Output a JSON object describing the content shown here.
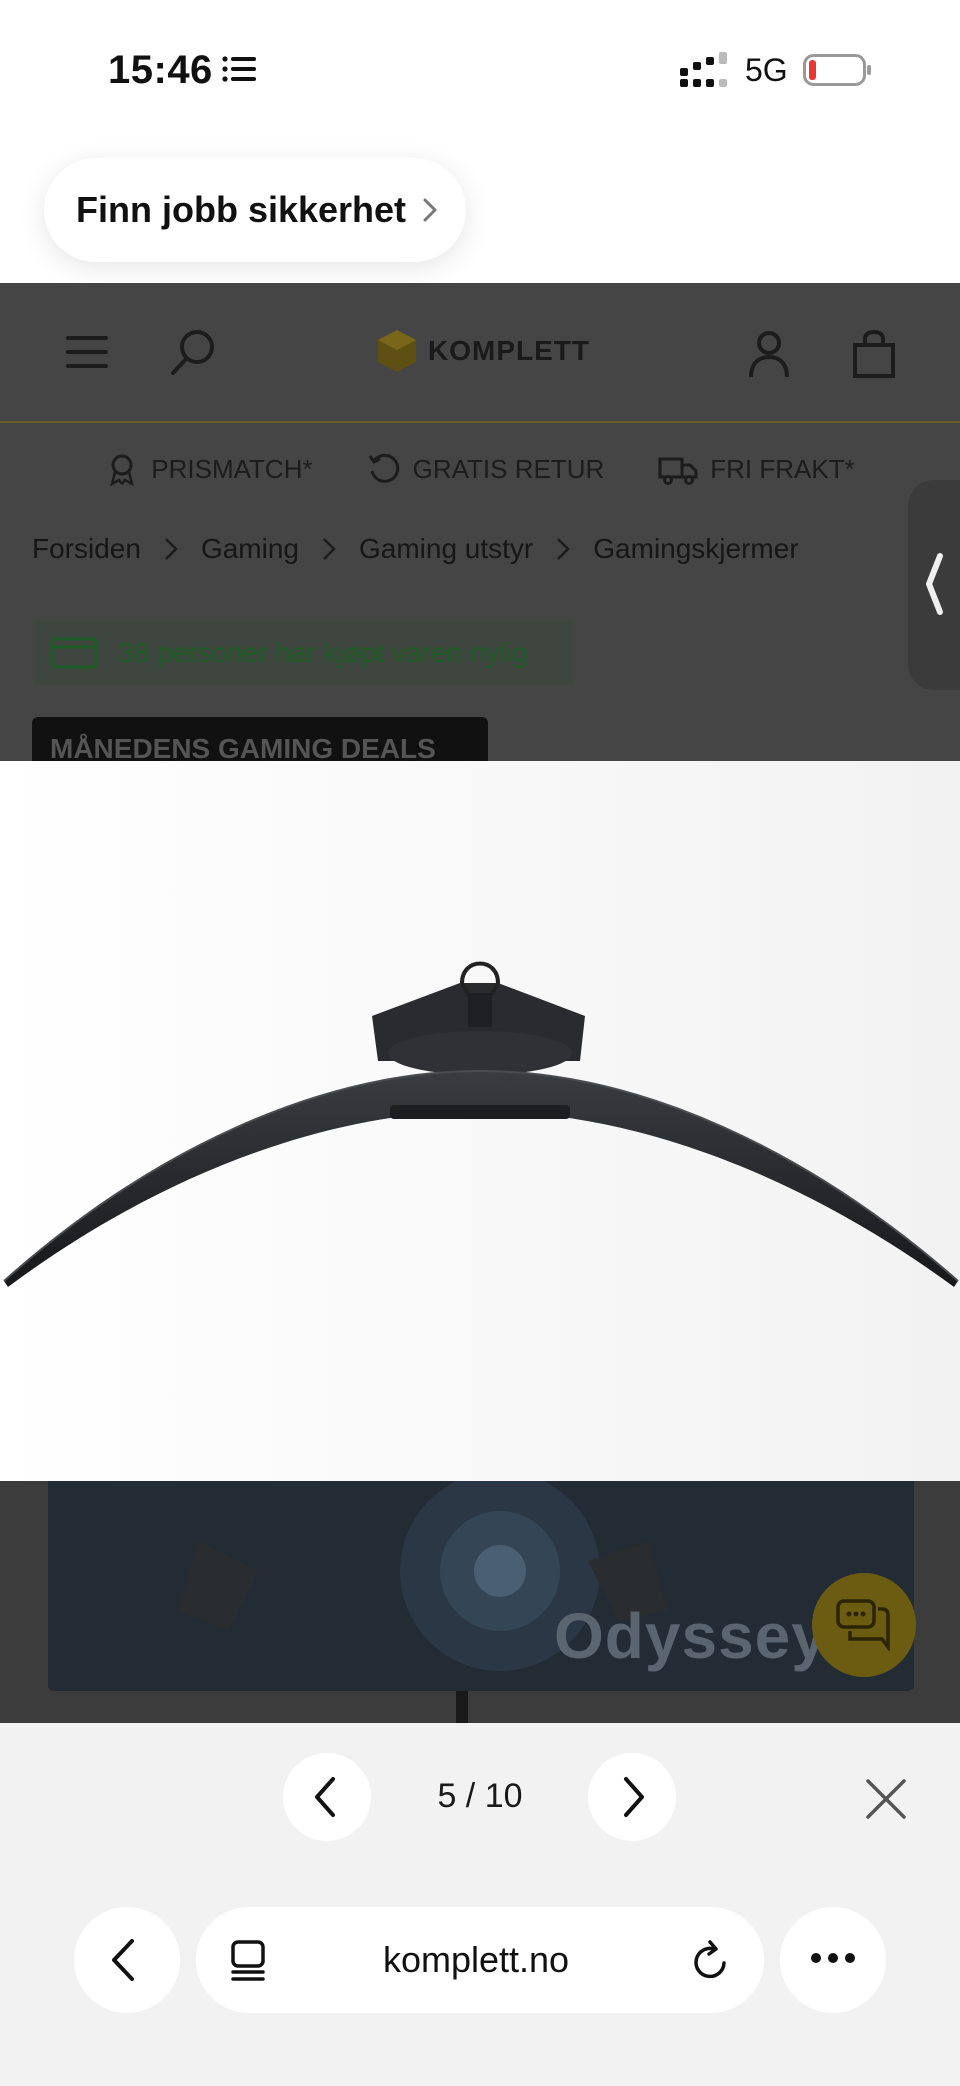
{
  "status_bar": {
    "time": "15:46",
    "network": "5G"
  },
  "promo": {
    "label": "Finn jobb sikkerhet"
  },
  "site": {
    "logo_text": "KOMPLETT",
    "usps": [
      "PRISMATCH*",
      "GRATIS RETUR",
      "FRI FRAKT*"
    ],
    "breadcrumb": [
      "Forsiden",
      "Gaming",
      "Gaming utstyr",
      "Gamingskjermer"
    ],
    "recent_buyers": "38 personer har kjøpt varen nylig",
    "deals_badge": "MÅNEDENS GAMING DEALS",
    "banner_text": "Odyssey"
  },
  "gallery": {
    "counter": "5 / 10"
  },
  "browser": {
    "url": "komplett.no"
  },
  "colors": {
    "overlay": "#454545",
    "accent": "#f2b705",
    "buyers_text": "#1d5c24",
    "battery_low": "#e53935"
  }
}
